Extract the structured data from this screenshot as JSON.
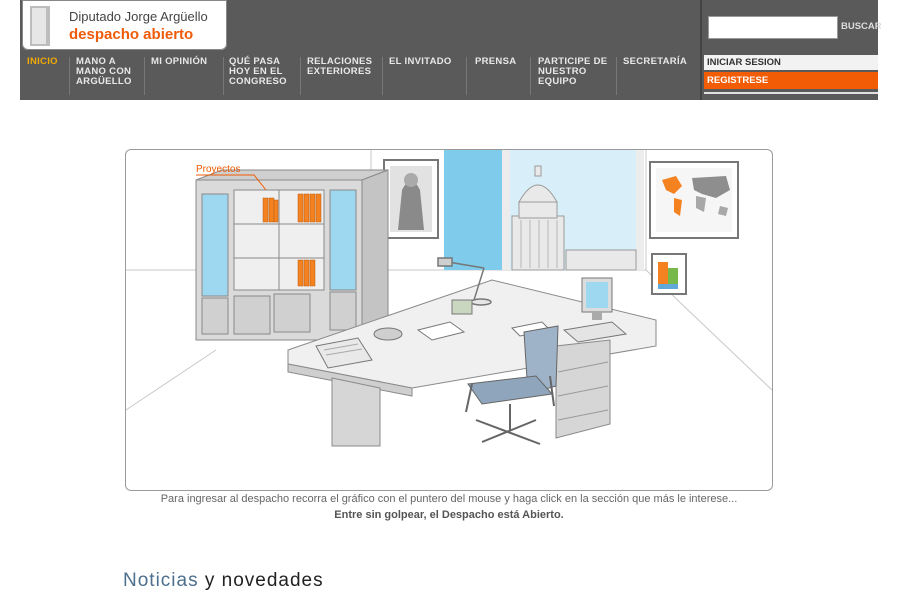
{
  "header": {
    "logo": {
      "name": "Diputado Jorge Argüello",
      "subtitle": "despacho abierto"
    },
    "nav": [
      {
        "label": "INICIO",
        "active": true
      },
      {
        "label": "MANO A MANO CON ARGÜELLO"
      },
      {
        "label": "MI OPINIÓN"
      },
      {
        "label": "QUÉ PASA HOY EN EL CONGRESO"
      },
      {
        "label": "RELACIONES EXTERIORES"
      },
      {
        "label": "EL INVITADO"
      },
      {
        "label": "PRENSA"
      },
      {
        "label": "PARTICIPE DE NUESTRO EQUIPO"
      },
      {
        "label": "SECRETARÍA"
      }
    ],
    "search": {
      "value": "",
      "button": "BUSCAR"
    },
    "login": "INICIAR SESION",
    "register": "REGISTRESE"
  },
  "office": {
    "projects_label": "Proyectos"
  },
  "instructions": "Para ingresar al despacho recorra el gráfico con el puntero del mouse y haga click en la sección que más le interese...",
  "tagline": "Entre sin golpear, el Despacho está Abierto.",
  "news": {
    "title_a": "Noticias",
    "title_b": "y novedades"
  },
  "colors": {
    "header_bg": "#5a5a5a",
    "accent_orange": "#f25c05",
    "active_nav": "#f2a900",
    "news_blue": "#4d6f8e"
  }
}
